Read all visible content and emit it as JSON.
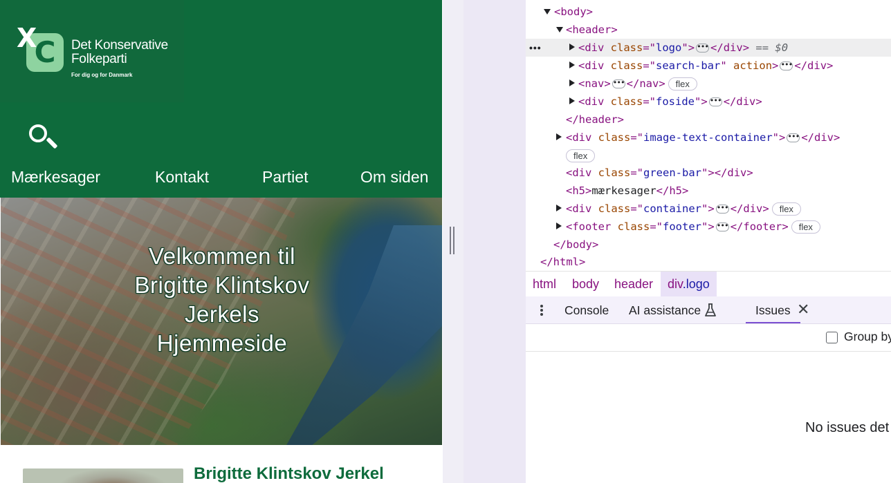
{
  "site": {
    "logo": {
      "party_name_line1": "Det Konservative",
      "party_name_line2": "Folkeparti",
      "tagline": "For dig og for Danmark",
      "letter": "C",
      "cross": "X"
    },
    "search_icon": "search-icon",
    "nav": [
      "Mærkesager",
      "Kontakt",
      "Partiet",
      "Om siden"
    ],
    "hero_title_lines": [
      "Velkommen til",
      "Brigitte Klintskov",
      "Jerkels",
      "Hjemmeside"
    ],
    "profile_name": "Brigitte Klintskov Jerkel",
    "brand_color": "#0e6b3c"
  },
  "devtools": {
    "elements": [
      {
        "open": "<body>",
        "expanded": true
      },
      {
        "open": "<header>",
        "expanded": true
      },
      {
        "tag": "div",
        "attr": "class",
        "value": "logo",
        "collapsed": true,
        "suffix": "== $0",
        "selected": true
      },
      {
        "tag": "div",
        "attr": "class",
        "value": "search-bar",
        "extra_attr": "action",
        "collapsed": true
      },
      {
        "tag": "nav",
        "collapsed": true,
        "badge": "flex"
      },
      {
        "tag": "div",
        "attr": "class",
        "value": "foside",
        "collapsed": true
      },
      {
        "close": "</header>"
      },
      {
        "tag": "div",
        "attr": "class",
        "value": "image-text-container",
        "collapsed": true,
        "badge": "flex"
      },
      {
        "tag": "div",
        "attr": "class",
        "value": "green-bar",
        "empty": true
      },
      {
        "tag": "h5",
        "text": "mærkesager"
      },
      {
        "tag": "div",
        "attr": "class",
        "value": "container",
        "collapsed": true,
        "badge": "flex"
      },
      {
        "tag": "footer",
        "attr": "class",
        "value": "footer",
        "collapsed": true,
        "badge": "flex"
      },
      {
        "close": "</body>"
      },
      {
        "close": "</html>"
      }
    ],
    "strings": {
      "body_open": "<body>",
      "header_open": "<header>",
      "header_close": "</header>",
      "body_close": "</body>",
      "html_close": "</html>",
      "div_open": "<div",
      "div_close": "</div>",
      "nav_open": "<nav>",
      "nav_close": "</nav>",
      "h5_open": "<h5>",
      "h5_close": "</h5>",
      "footer_open": "<footer",
      "footer_close": "</footer>",
      "gt": ">",
      "class_attr": "class",
      "eq_quote": "=\"",
      "quote": "\"",
      "action_attr": "action",
      "logo": "logo",
      "search_bar": "search-bar",
      "foside": "foside",
      "image_text_container": "image-text-container",
      "green_bar": "green-bar",
      "container": "container",
      "footer": "footer",
      "h5_text": "mærkesager",
      "selected_suffix": "== $0",
      "ellipsis": "•••",
      "flex": "flex",
      "gutter_dots": "•••"
    },
    "breadcrumbs": [
      "html",
      "body",
      "header",
      "div.logo"
    ],
    "breadcrumb_active": {
      "tag": "div",
      "cls": ".logo"
    },
    "drawer_tabs": {
      "console": "Console",
      "ai_assistance": "AI assistance",
      "issues": "Issues",
      "close": "✕"
    },
    "group_by_label": "Group by",
    "no_issues_text": "No issues det",
    "accent_color": "#7b4fd1"
  }
}
